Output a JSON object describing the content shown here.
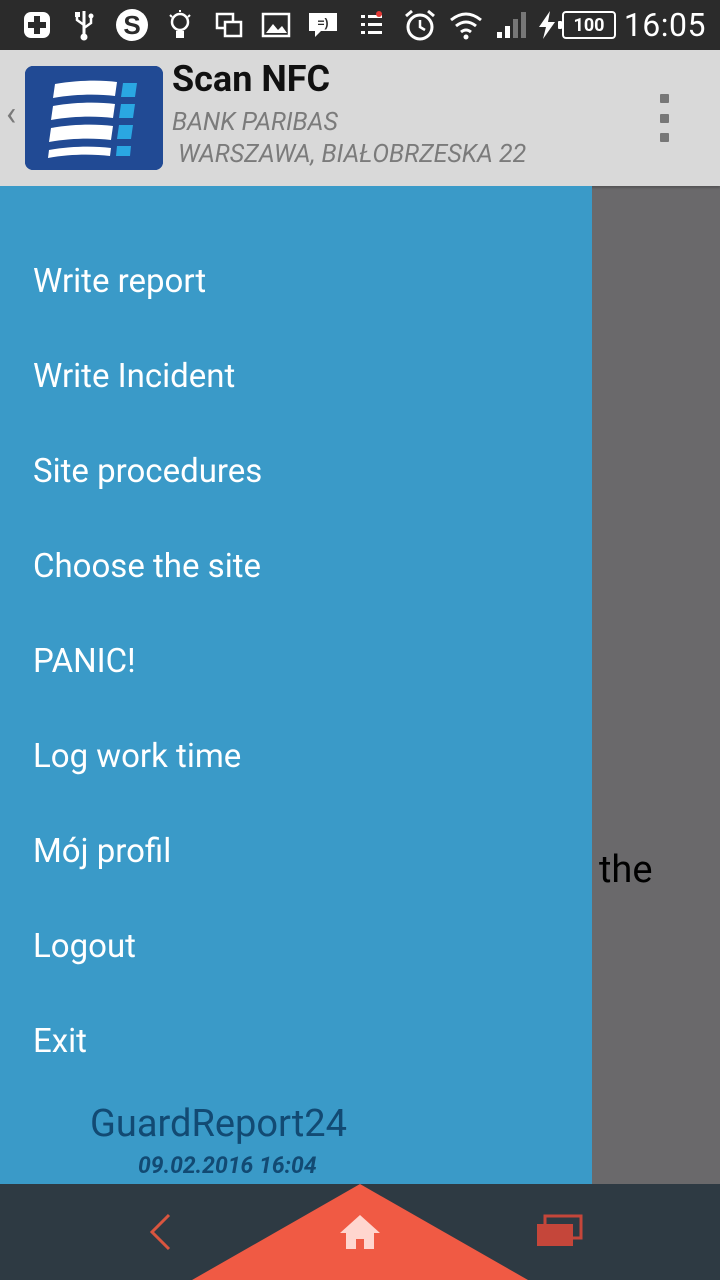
{
  "status_bar": {
    "battery": "100",
    "time": "16:05",
    "icons": [
      "add-icon",
      "usb-icon",
      "skype-icon",
      "bulb-icon",
      "copy-icon",
      "image-icon",
      "message-icon",
      "notification-icon",
      "alarm-icon",
      "wifi-icon",
      "signal-icon",
      "charging-icon"
    ]
  },
  "app_bar": {
    "title": "Scan NFC",
    "subtitle_line1": "BANK PARIBAS",
    "subtitle_line2": "WARSZAWA, BIAŁOBRZESKA 22"
  },
  "drawer": {
    "items": [
      {
        "label": "Write report"
      },
      {
        "label": "Write Incident"
      },
      {
        "label": "Site procedures"
      },
      {
        "label": "Choose the site"
      },
      {
        "label": "PANIC!"
      },
      {
        "label": "Log work time"
      },
      {
        "label": "Mój profil"
      },
      {
        "label": "Logout"
      },
      {
        "label": "Exit"
      }
    ],
    "brand": "GuardReport24",
    "timestamp": "09.02.2016 16:04"
  },
  "background_text": "the",
  "colors": {
    "drawer_bg": "#3a9ac8",
    "app_bar_bg": "#d9d9d9",
    "nav_bg": "#2e3a43",
    "nav_accent": "#f05a44",
    "brand_text": "#124a73"
  }
}
